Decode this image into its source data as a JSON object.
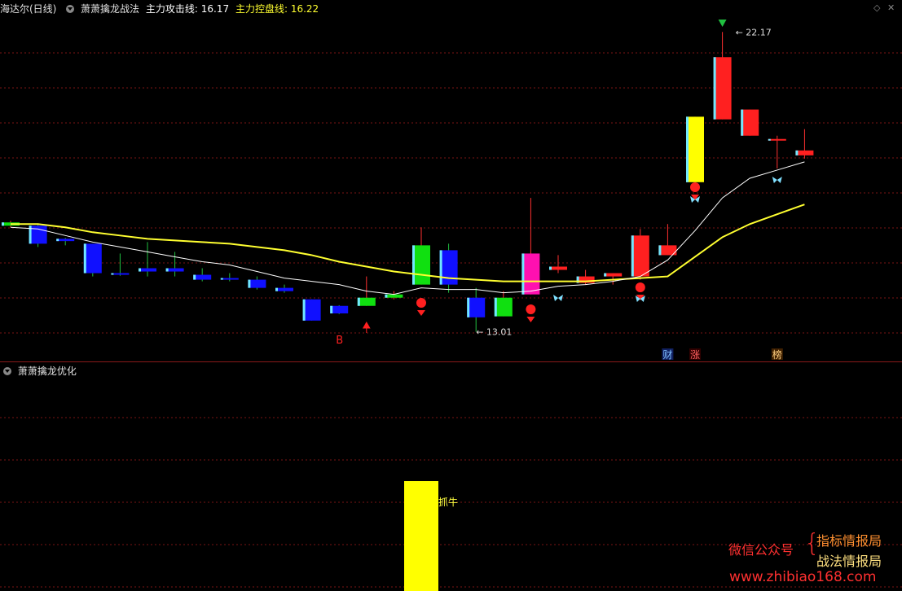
{
  "top": {
    "stock_name": "海达尔(日线)",
    "indicator_name": "萧萧擒龙战法",
    "line1_label": "主力攻击线:",
    "line1_value": "16.17",
    "line2_label": "主力控盘线:",
    "line2_value": "16.22",
    "high_label": "22.17",
    "low_label": "13.01",
    "signal_b": "B",
    "tag_cai": "财",
    "tag_zhang": "涨",
    "tag_bang": "榜"
  },
  "bottom": {
    "indicator_name": "萧萧擒龙优化",
    "bar_label": "抓牛"
  },
  "watermark": {
    "line_a": "微信公众号",
    "line_b1": "指标情报局",
    "line_b2": "战法情报局",
    "url": "www.zhibiao168.com"
  },
  "colors": {
    "background": "#000000",
    "up_red": "#ff2020",
    "down_blue": "#1010ff",
    "green": "#10e010",
    "magenta": "#ff10b0",
    "cyan": "#70e8ff",
    "yellow_line": "#ffff30",
    "white_line": "#ffffff",
    "grid": "#7a1414"
  },
  "chart_data": {
    "type": "candlestick",
    "candles": [
      {
        "o": 16.35,
        "h": 16.4,
        "l": 16.2,
        "c": 16.25,
        "color": "green"
      },
      {
        "o": 16.25,
        "h": 16.3,
        "l": 15.6,
        "c": 15.7,
        "color": "blue"
      },
      {
        "o": 15.85,
        "h": 15.88,
        "l": 15.65,
        "c": 15.78,
        "color": "blue"
      },
      {
        "o": 15.7,
        "h": 15.7,
        "l": 14.7,
        "c": 14.8,
        "color": "blue"
      },
      {
        "o": 14.8,
        "h": 15.4,
        "l": 14.72,
        "c": 14.78,
        "color": "blue"
      },
      {
        "o": 14.95,
        "h": 15.75,
        "l": 14.7,
        "c": 14.85,
        "color": "blue"
      },
      {
        "o": 14.95,
        "h": 15.45,
        "l": 14.7,
        "c": 14.85,
        "color": "blue"
      },
      {
        "o": 14.75,
        "h": 14.95,
        "l": 14.55,
        "c": 14.6,
        "color": "blue"
      },
      {
        "o": 14.65,
        "h": 14.8,
        "l": 14.55,
        "c": 14.6,
        "color": "blue"
      },
      {
        "o": 14.6,
        "h": 14.7,
        "l": 14.3,
        "c": 14.35,
        "color": "blue"
      },
      {
        "o": 14.35,
        "h": 14.45,
        "l": 14.2,
        "c": 14.25,
        "color": "blue"
      },
      {
        "o": 14.0,
        "h": 14.0,
        "l": 13.35,
        "c": 13.35,
        "color": "blue"
      },
      {
        "o": 13.8,
        "h": 13.82,
        "l": 13.55,
        "c": 13.57,
        "color": "blue"
      },
      {
        "o": 13.8,
        "h": 14.7,
        "l": 13.8,
        "c": 14.05,
        "color": "green"
      },
      {
        "o": 14.05,
        "h": 14.25,
        "l": 14.0,
        "c": 14.15,
        "color": "green"
      },
      {
        "o": 14.45,
        "h": 16.2,
        "l": 14.45,
        "c": 15.65,
        "color": "green"
      },
      {
        "o": 15.5,
        "h": 15.7,
        "l": 14.2,
        "c": 14.45,
        "color": "blue"
      },
      {
        "o": 14.05,
        "h": 14.35,
        "l": 13.01,
        "c": 13.45,
        "color": "blue"
      },
      {
        "o": 14.05,
        "h": 14.25,
        "l": 13.48,
        "c": 13.48,
        "color": "green"
      },
      {
        "o": 14.15,
        "h": 17.1,
        "l": 14.15,
        "c": 15.4,
        "color": "magenta"
      },
      {
        "o": 14.9,
        "h": 15.35,
        "l": 14.8,
        "c": 15.0,
        "color": "red"
      },
      {
        "o": 14.7,
        "h": 14.9,
        "l": 14.45,
        "c": 14.5,
        "color": "red"
      },
      {
        "o": 14.7,
        "h": 14.8,
        "l": 14.45,
        "c": 14.8,
        "color": "red"
      },
      {
        "o": 14.7,
        "h": 16.15,
        "l": 14.6,
        "c": 15.95,
        "color": "red"
      },
      {
        "o": 15.35,
        "h": 16.3,
        "l": 15.35,
        "c": 15.65,
        "color": "red"
      },
      {
        "o": 17.58,
        "h": 19.58,
        "l": 17.58,
        "c": 19.58,
        "color": "yellow"
      },
      {
        "o": 19.5,
        "h": 22.17,
        "l": 19.5,
        "c": 21.4,
        "color": "red"
      },
      {
        "o": 19.8,
        "h": 19.2,
        "l": 19.2,
        "c": 19.0,
        "color": "red"
      },
      {
        "o": 18.85,
        "h": 19.0,
        "l": 18.0,
        "c": 18.9,
        "color": "red"
      },
      {
        "o": 18.55,
        "h": 19.2,
        "l": 18.3,
        "c": 18.4,
        "color": "red"
      }
    ],
    "attack_line": [
      16.2,
      16.15,
      15.95,
      15.75,
      15.6,
      15.45,
      15.3,
      15.15,
      15.05,
      14.85,
      14.65,
      14.55,
      14.45,
      14.25,
      14.15,
      14.35,
      14.3,
      14.3,
      14.2,
      14.25,
      14.4,
      14.45,
      14.55,
      14.7,
      15.2,
      16.1,
      17.1,
      17.7,
      17.95,
      18.2
    ],
    "control_line": [
      16.3,
      16.3,
      16.2,
      16.05,
      15.95,
      15.85,
      15.8,
      15.75,
      15.7,
      15.6,
      15.5,
      15.35,
      15.15,
      15.0,
      14.85,
      14.75,
      14.65,
      14.6,
      14.55,
      14.55,
      14.55,
      14.55,
      14.6,
      14.65,
      14.7,
      15.3,
      15.9,
      16.3,
      16.6,
      16.9
    ],
    "ylim": [
      12.5,
      22.6
    ],
    "high_label": "22.17",
    "low_label": "13.01",
    "bottom_bar": {
      "index": 15,
      "label": "抓牛"
    }
  }
}
